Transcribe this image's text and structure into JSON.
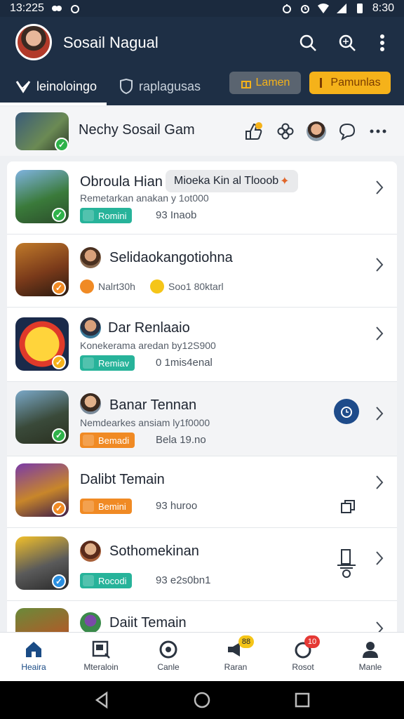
{
  "status_bar": {
    "time_left": "13:225",
    "time_right": "8:30"
  },
  "header": {
    "title": "Sosail Nagual",
    "tabs": [
      {
        "label": "leinoloingo",
        "active": true
      },
      {
        "label": "raplagusas",
        "active": false
      }
    ],
    "chips": [
      {
        "label": "Lamen",
        "color": "#5a6470"
      },
      {
        "label": "Pamunlas",
        "color": "#f5b21a"
      }
    ]
  },
  "social": {
    "title": "Nechy Sosail Gam"
  },
  "rows": [
    {
      "name": "Obroula Hian",
      "tooltip": "Mioeka Kin al Tlooob",
      "subtitle": "Remetarkan anakan y 1ot000",
      "badge": "Romini",
      "badge_color": "#27b39a",
      "extra": "93 Inaob",
      "check_color": "#2fb24a"
    },
    {
      "name": "Selidaokangotiohna",
      "subtitle_left": "Nalrt30h",
      "subtitle_right": "Soo1 80ktarl",
      "check_color": "#f08a24"
    },
    {
      "name": "Dar Renlaaio",
      "subtitle": "Konekerama aredan by12S900",
      "badge": "Remiav",
      "badge_color": "#27b39a",
      "extra": "0 1mis4enal",
      "check_color": "#f5b21a"
    },
    {
      "name": "Banar Tennan",
      "subtitle": "Nemdearkes ansiam ly1f0000",
      "badge": "Bemadi",
      "badge_color": "#f08a24",
      "extra": "Bela 19.no",
      "check_color": "#2fb24a"
    },
    {
      "name": "Dalibt Temain",
      "badge": "Bemini",
      "badge_color": "#f08a24",
      "extra": "93 huroo",
      "check_color": "#f08a24"
    },
    {
      "name": "Sothomekinan",
      "badge": "Rocodi",
      "badge_color": "#27b39a",
      "extra": "93 e2s0bn1",
      "check_color": "#2a8fe0"
    },
    {
      "name": "Daiit Temain"
    }
  ],
  "bottom_nav": [
    {
      "label": "Heaira",
      "active": true
    },
    {
      "label": "Mteraloin",
      "active": false
    },
    {
      "label": "Canle",
      "active": false
    },
    {
      "label": "Raran",
      "active": false,
      "badge": "88",
      "badge_color": "#f5c518"
    },
    {
      "label": "Rosot",
      "active": false,
      "badge": "10",
      "badge_color": "#e53935"
    },
    {
      "label": "Manle",
      "active": false
    }
  ]
}
